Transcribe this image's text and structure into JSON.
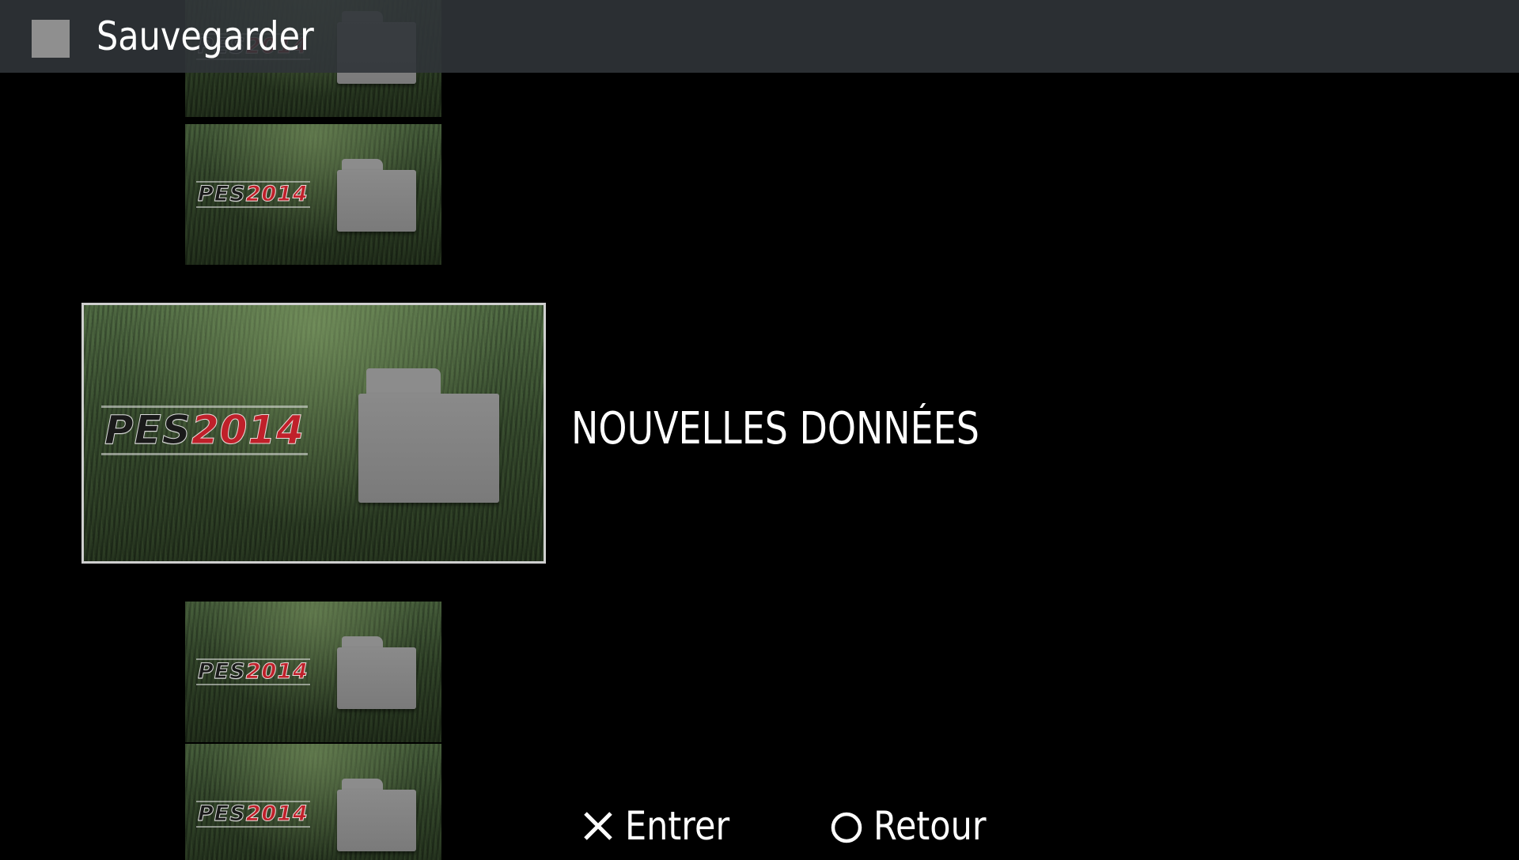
{
  "header": {
    "title": "Sauvegarder"
  },
  "save_list": {
    "selected_label": "NOUVELLES DONNÉES",
    "thumbnail": {
      "logo_main": "PES",
      "logo_year": "2014"
    }
  },
  "controls": {
    "enter_label": "Entrer",
    "back_label": "Retour",
    "enter_icon": "cross-button-icon",
    "back_icon": "circle-button-icon"
  },
  "colors": {
    "background": "#000000",
    "header_bar": "#303438",
    "selection_border": "#cfcfcf",
    "logo_year": "#c0202a"
  }
}
